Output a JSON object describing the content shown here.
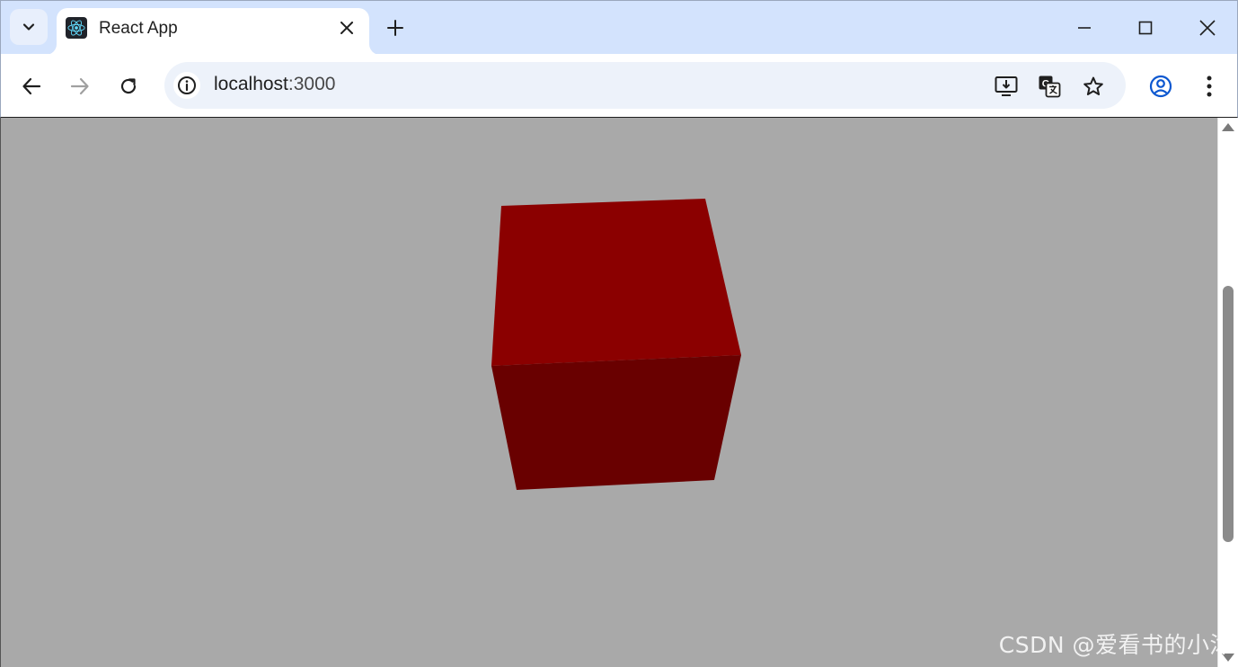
{
  "tab": {
    "title": "React App"
  },
  "omnibox": {
    "host": "localhost",
    "port": ":3000"
  },
  "scene": {
    "background_color": "#a9a9a9",
    "object": "cube",
    "top_face_color": "#8b0000",
    "front_face_color": "#690000"
  },
  "watermark": {
    "text": "CSDN @爱看书的小沐"
  },
  "icons": {
    "tab_search": "chevron-down-icon",
    "favicon": "react-logo-icon",
    "tab_close": "close-icon",
    "new_tab": "plus-icon",
    "minimize": "minimize-icon",
    "maximize": "maximize-icon",
    "window_close": "close-icon",
    "back": "arrow-left-icon",
    "forward": "arrow-right-icon",
    "reload": "reload-icon",
    "site_info": "info-icon",
    "install": "install-app-icon",
    "translate": "translate-icon",
    "bookmark": "star-icon",
    "profile": "profile-icon",
    "menu": "more-vert-icon"
  }
}
